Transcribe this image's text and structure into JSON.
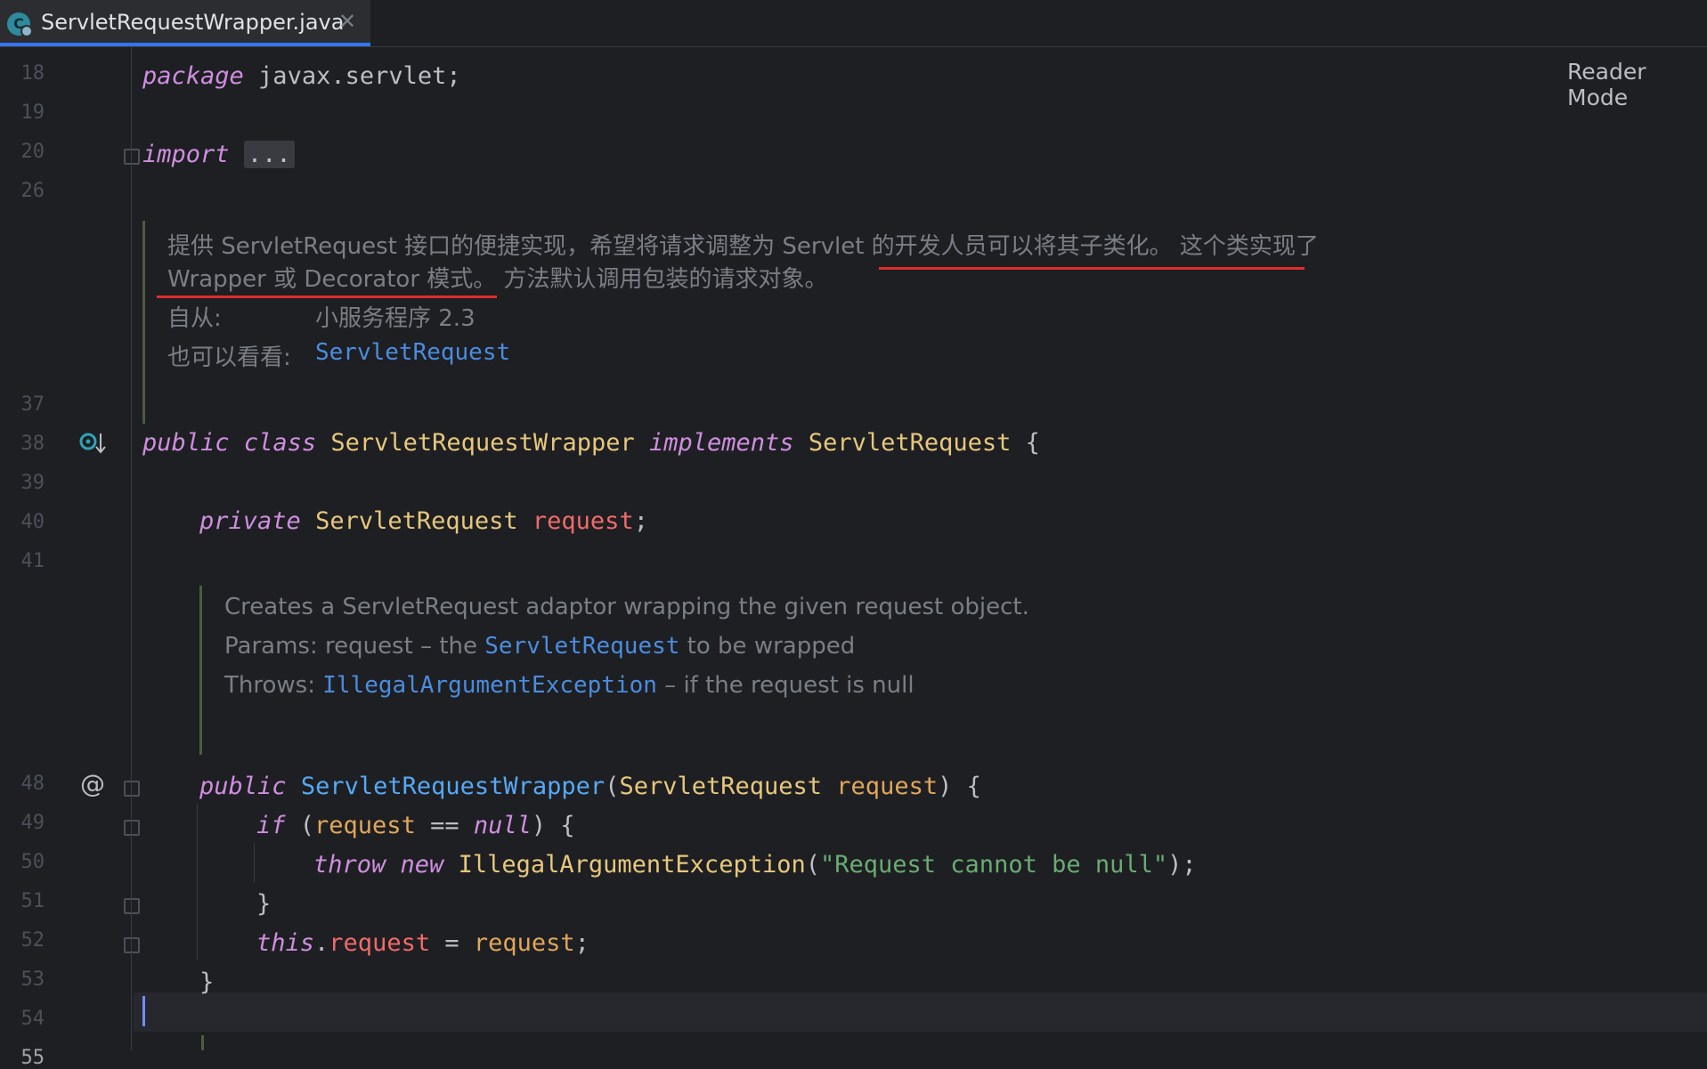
{
  "tab": {
    "title": "ServletRequestWrapper.java",
    "icon_letter": "C"
  },
  "reader_mode": "Reader Mode",
  "line_numbers": [
    "18",
    "19",
    "20",
    "26",
    "37",
    "38",
    "39",
    "40",
    "41",
    "48",
    "49",
    "50",
    "51",
    "52",
    "53",
    "54",
    "55"
  ],
  "code": {
    "l18": {
      "kw": "package",
      "rest": " javax.servlet;"
    },
    "l20": {
      "kw": "import",
      "dots": "..."
    },
    "l38": {
      "kw1": "public",
      "kw2": "class",
      "name": "ServletRequestWrapper",
      "kw3": "implements",
      "iface": "ServletRequest",
      "brace": " {"
    },
    "l40": {
      "kw": "private",
      "type": "ServletRequest",
      "field": "request",
      "semi": ";"
    },
    "l48": {
      "kw": "public",
      "ctor": "ServletRequestWrapper",
      "open": "(",
      "type": "ServletRequest",
      "param": "request",
      "close": ") {"
    },
    "l49": {
      "kw": "if",
      "open": " (",
      "param": "request",
      "op": " == ",
      "null": "null",
      "close": ") {"
    },
    "l50": {
      "kw1": "throw",
      "kw2": "new",
      "exc": "IllegalArgumentException",
      "open": "(",
      "str": "\"Request cannot be null\"",
      "close": ");"
    },
    "l51": "}",
    "l52": {
      "kw": "this",
      "dot": ".",
      "field": "request",
      "eq": " = ",
      "param": "request",
      "semi": ";"
    },
    "l53": "}"
  },
  "doc1": {
    "line1": "提供 ServletRequest 接口的便捷实现，希望将请求调整为 Servlet 的开发人员可以将其子类化。 这个类实现了",
    "line2": "Wrapper 或 Decorator 模式。 方法默认调用包装的请求对象。",
    "since_label": "自从:",
    "since_value": "小服务程序 2.3",
    "see_label": "也可以看看:",
    "see_value": "ServletRequest"
  },
  "doc2": {
    "line1": "Creates a ServletRequest adaptor wrapping the given request object.",
    "params_label": "Params:",
    "params_pre": "request – the ",
    "params_link": "ServletRequest",
    "params_post": " to be wrapped",
    "throws_label": "Throws:",
    "throws_link": "IllegalArgumentException",
    "throws_post": " – if the request is null"
  },
  "gutter_icons": {
    "l38": "implemented-icon",
    "l48": "@"
  },
  "colors": {
    "background": "#1e1f22",
    "keyword": "#cf8ee0",
    "class": "#e7c77d",
    "field": "#f16a6a",
    "string": "#6aab73",
    "link": "#4b8ce0",
    "annotation_underline": "#e02d2d",
    "caret": "#6f8cff"
  }
}
